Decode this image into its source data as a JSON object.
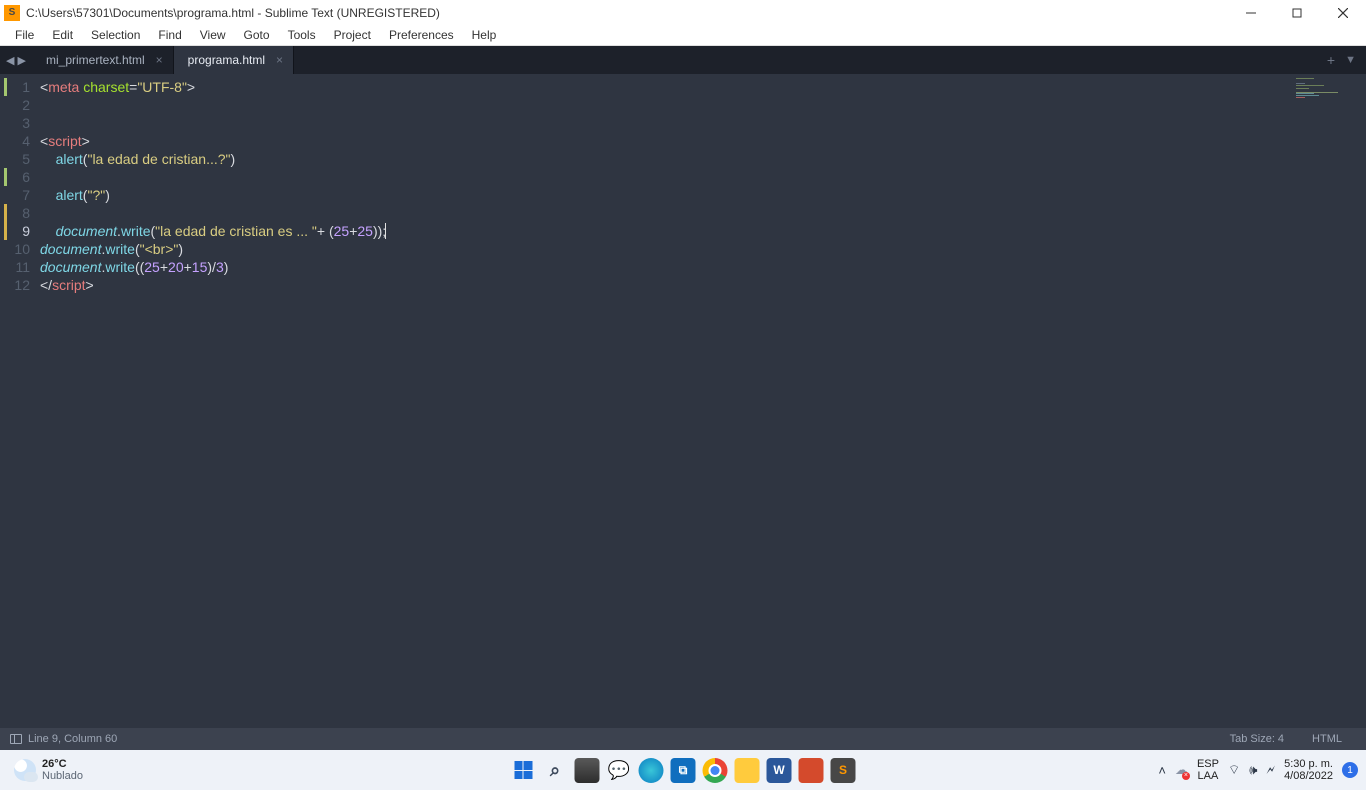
{
  "title": "C:\\Users\\57301\\Documents\\programa.html - Sublime Text (UNREGISTERED)",
  "menu": {
    "file": "File",
    "edit": "Edit",
    "selection": "Selection",
    "find": "Find",
    "view": "View",
    "goto": "Goto",
    "tools": "Tools",
    "project": "Project",
    "preferences": "Preferences",
    "help": "Help"
  },
  "tabs": [
    {
      "label": "mi_primertext.html",
      "active": false
    },
    {
      "label": "programa.html",
      "active": true
    }
  ],
  "status": {
    "pos": "Line 9, Column 60",
    "tabsize": "Tab Size: 4",
    "syntax": "HTML"
  },
  "code": {
    "total_lines": 12,
    "current_line": 9
  },
  "weather": {
    "temp": "26°C",
    "desc": "Nublado"
  },
  "tray": {
    "lang1": "ESP",
    "lang2": "LAA",
    "time": "5:30 p. m.",
    "date": "4/08/2022",
    "notif": "1"
  }
}
